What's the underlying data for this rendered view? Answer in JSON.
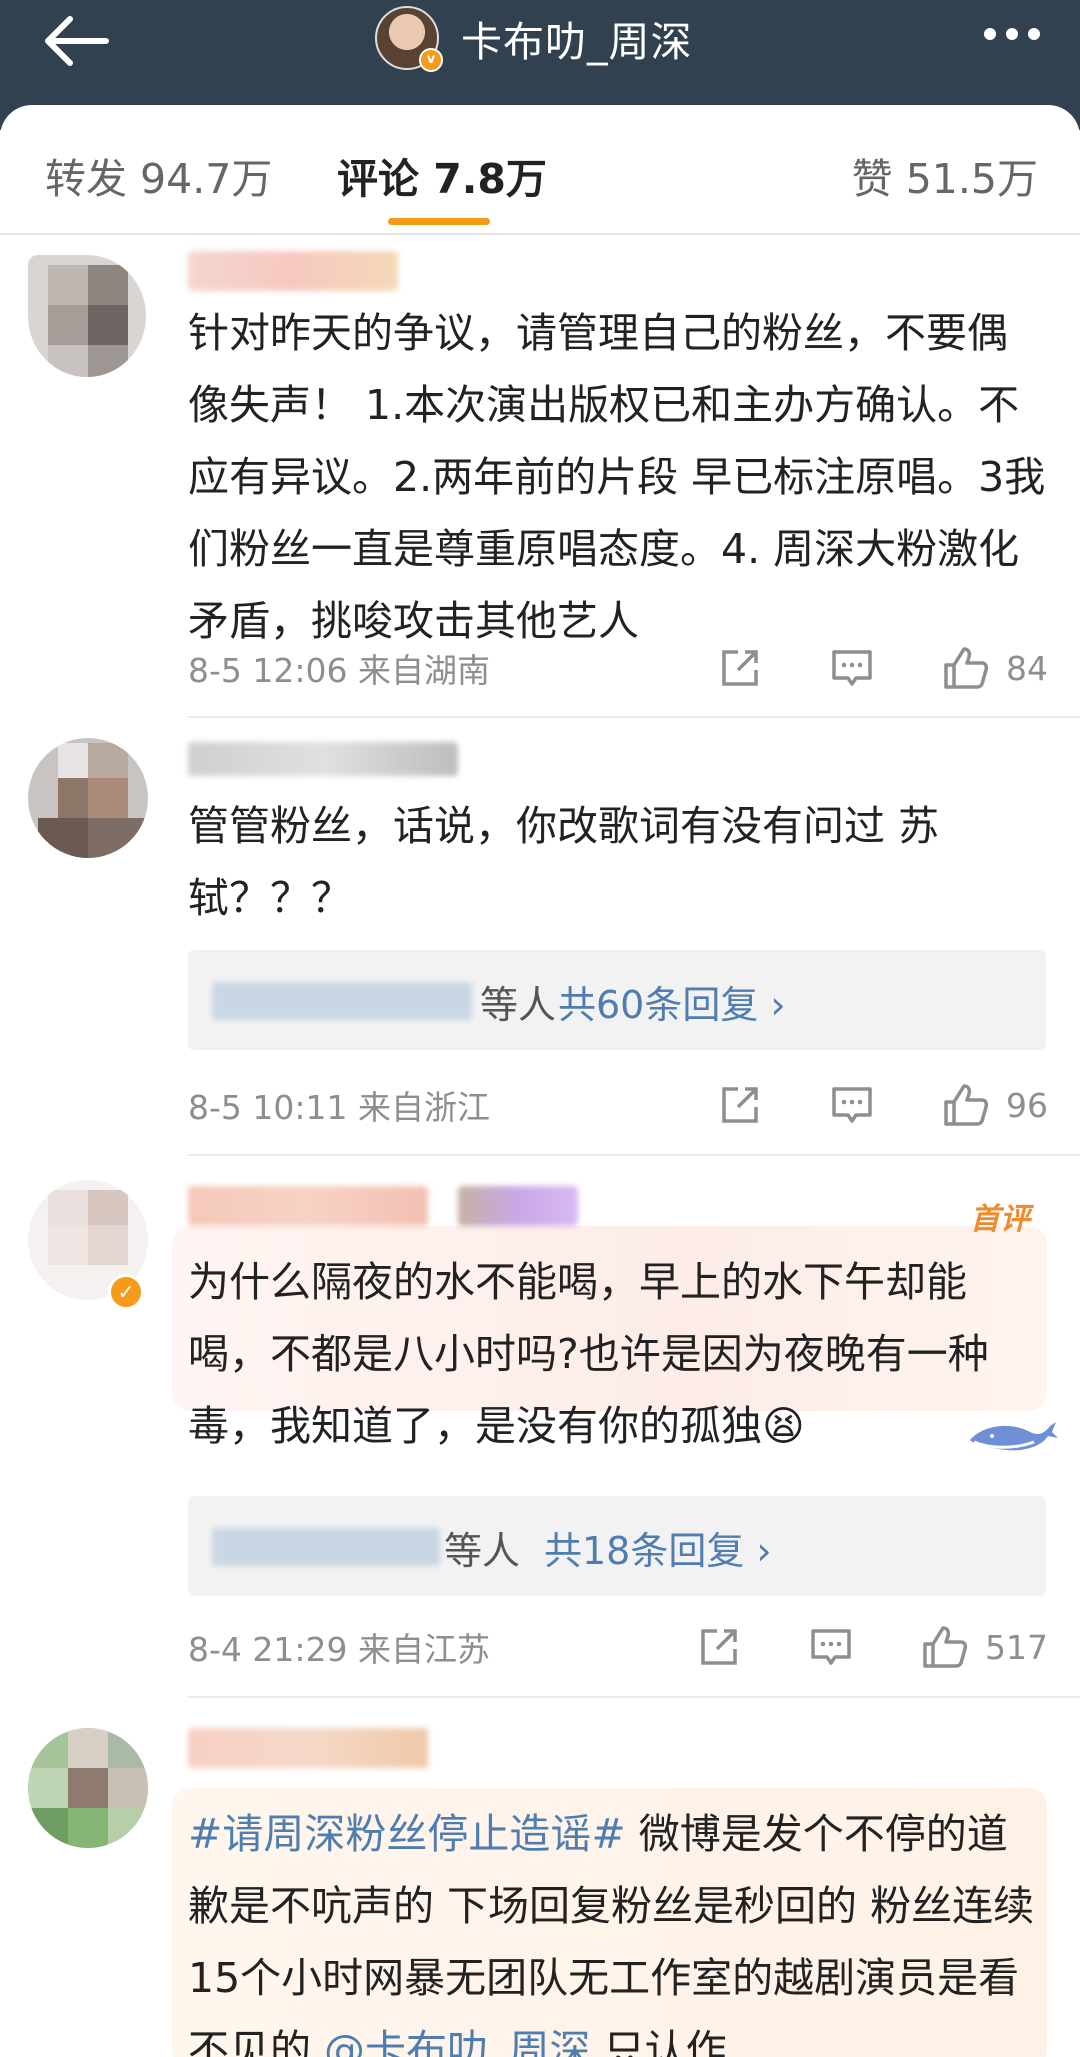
{
  "header": {
    "back_icon": "back-arrow-icon",
    "title": "卡布叻_周深",
    "more_icon": "more-dots-icon",
    "verified_badge": "v",
    "bar_color": "#314150"
  },
  "tabs": {
    "repost": "转发 94.7万",
    "comment": "评论 7.8万",
    "like": "赞 51.5万",
    "active": "comment",
    "accent": "#f49a16"
  },
  "comments": [
    {
      "text": "针对昨天的争议，请管理自己的粉丝，不要偶像失声！ 1.本次演出版权已和主办方确认。不应有异议。2.两年前的片段 早已标注原唱。3我们粉丝一直是尊重原唱态度。4. 周深大粉激化矛盾，挑唆攻击其他艺人",
      "time": "8-5 12:06 来自湖南",
      "likes": "84"
    },
    {
      "text": "管管粉丝，话说，你改歌词有没有问过 苏轼？？？",
      "reply_who": "等人",
      "reply_link": "共60条回复 ›",
      "time": "8-5 10:11 来自浙江",
      "likes": "96"
    },
    {
      "badge": "首评",
      "text": "为什么隔夜的水不能喝，早上的水下午却能喝，不都是八小时吗?也许是因为夜晚有一种毒，我知道了，是没有你的孤独😫",
      "reply_who": "等人",
      "reply_link": "共18条回复 ›",
      "time": "8-4 21:29 来自江苏",
      "likes": "517"
    },
    {
      "topic": "#请周深粉丝停止造谣#",
      "text": " 微博是发个不停的道歉是不吭声的 下场回复粉丝是秒回的 粉丝连续15个小时网暴无团队无工作室的越剧演员是看不见的 ",
      "mention": "@卡布叻_周深",
      "tail": " 只认作"
    }
  ],
  "colors": {
    "link": "#507daf",
    "meta": "#8e8e8e",
    "first_comment_badge": "#f08a2c"
  }
}
